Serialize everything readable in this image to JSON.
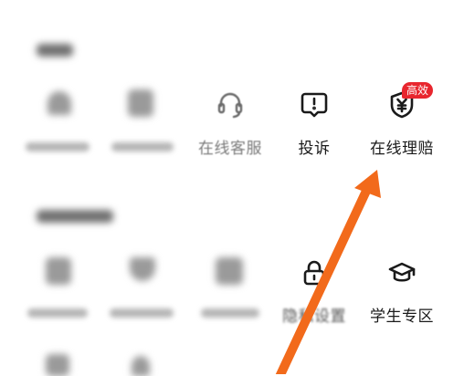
{
  "section1": {
    "items": [
      {
        "label": ""
      },
      {
        "label": ""
      },
      {
        "label": "在线客服",
        "icon": "headset-icon"
      },
      {
        "label": "投诉",
        "icon": "complaint-icon"
      },
      {
        "label": "在线理赔",
        "icon": "shield-yen-icon",
        "badge": "高效"
      }
    ]
  },
  "section2": {
    "items": [
      {
        "label": ""
      },
      {
        "label": ""
      },
      {
        "label": ""
      },
      {
        "label": "隐私设置",
        "icon": "lock-icon"
      },
      {
        "label": "学生专区",
        "icon": "graduation-cap-icon"
      }
    ]
  },
  "colors": {
    "badge": "#e8262e",
    "arrow": "#f26a1b",
    "text": "#1a1a1a"
  }
}
